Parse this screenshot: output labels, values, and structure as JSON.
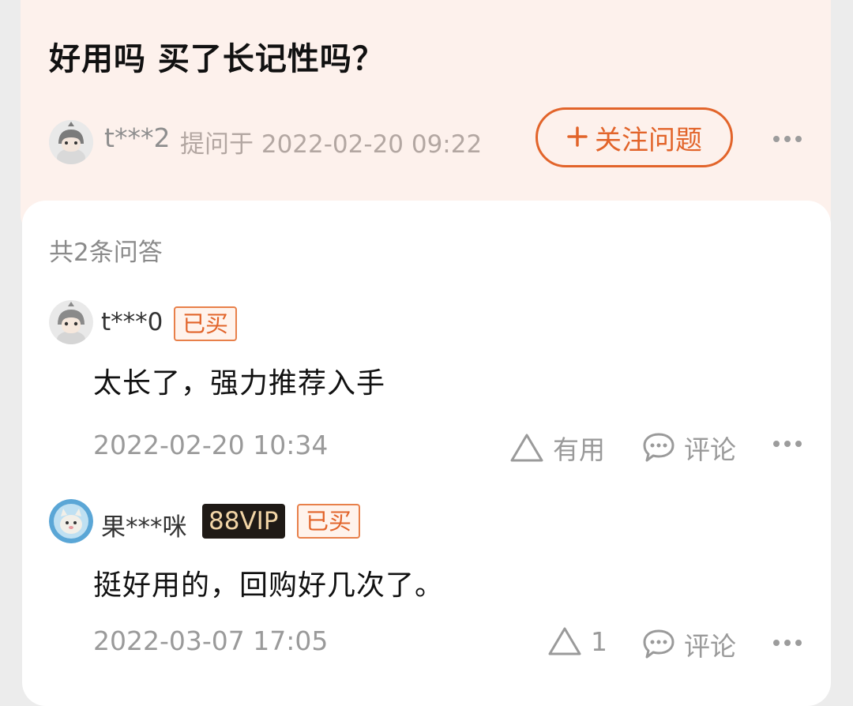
{
  "question": {
    "title": "好用吗 买了长记性吗？",
    "asker": "t***2",
    "asked_meta": "提问于 2022-02-20 09:22",
    "follow_label": "关注问题",
    "follow_icon": "plus-icon"
  },
  "answers_section": {
    "count_label": "共2条问答",
    "answers": [
      {
        "user": "t***0",
        "badge": "已买",
        "text": "太长了，强力推荐入手",
        "time": "2022-02-20 10:34",
        "useful_label": "有用",
        "comment_label": "评论"
      },
      {
        "user": "果***咪",
        "vip_badge": "88VIP",
        "badge": "已买",
        "text": "挺好用的，回购好几次了。",
        "time": "2022-03-07 17:05",
        "useful_count": "1",
        "comment_label": "评论"
      }
    ]
  },
  "colors": {
    "accent": "#e2642a",
    "header_bg": "#fdf1ec",
    "vip_bg": "#1f1a16",
    "vip_text": "#f2d5a6"
  }
}
